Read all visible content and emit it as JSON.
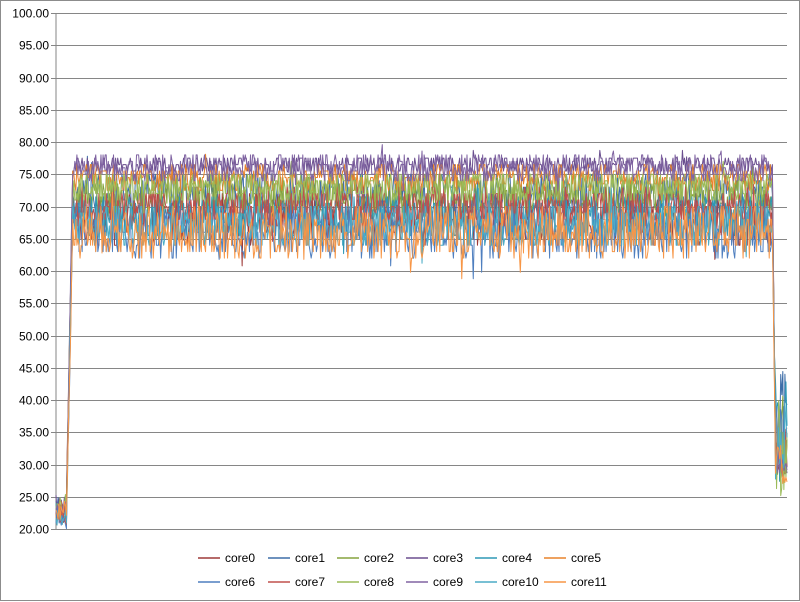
{
  "chart_data": {
    "type": "line",
    "title": "",
    "xlabel": "",
    "ylabel": "",
    "ylim": [
      20,
      100
    ],
    "y_ticks": [
      "20.00",
      "25.00",
      "30.00",
      "35.00",
      "40.00",
      "45.00",
      "50.00",
      "55.00",
      "60.00",
      "65.00",
      "70.00",
      "75.00",
      "80.00",
      "85.00",
      "90.00",
      "95.00",
      "100.00"
    ],
    "grid": true,
    "legend_position": "bottom",
    "n_points": 700,
    "series": [
      {
        "name": "core0",
        "color": "#9e3a38",
        "idle": 22.0,
        "load": 68.0,
        "amp": 4.0,
        "drop": 31.0,
        "tail_amp": 3.0
      },
      {
        "name": "core1",
        "color": "#3e6ea8",
        "idle": 23.5,
        "load": 72.0,
        "amp": 3.5,
        "drop": 35.0,
        "tail_amp": 10.0
      },
      {
        "name": "core2",
        "color": "#86a33f",
        "idle": 23.0,
        "load": 71.5,
        "amp": 3.0,
        "drop": 33.0,
        "tail_amp": 8.0
      },
      {
        "name": "core3",
        "color": "#6b4f8f",
        "idle": 24.0,
        "load": 76.5,
        "amp": 1.5,
        "drop": 30.0,
        "tail_amp": 2.0
      },
      {
        "name": "core4",
        "color": "#2f98b5",
        "idle": 22.5,
        "load": 68.5,
        "amp": 3.5,
        "drop": 36.0,
        "tail_amp": 9.0
      },
      {
        "name": "core5",
        "color": "#e8842c",
        "idle": 23.0,
        "load": 74.5,
        "amp": 2.0,
        "drop": 31.0,
        "tail_amp": 3.0
      },
      {
        "name": "core6",
        "color": "#4f7fbf",
        "idle": 22.0,
        "load": 66.0,
        "amp": 4.0,
        "drop": 34.0,
        "tail_amp": 6.0
      },
      {
        "name": "core7",
        "color": "#c0504d",
        "idle": 22.5,
        "load": 70.0,
        "amp": 3.0,
        "drop": 32.0,
        "tail_amp": 4.0
      },
      {
        "name": "core8",
        "color": "#9bbb59",
        "idle": 24.0,
        "load": 73.0,
        "amp": 2.5,
        "drop": 33.0,
        "tail_amp": 8.0
      },
      {
        "name": "core9",
        "color": "#8064a2",
        "idle": 23.0,
        "load": 76.0,
        "amp": 2.0,
        "drop": 31.0,
        "tail_amp": 3.0
      },
      {
        "name": "core10",
        "color": "#4bacc6",
        "idle": 22.0,
        "load": 67.0,
        "amp": 3.5,
        "drop": 35.0,
        "tail_amp": 8.0
      },
      {
        "name": "core11",
        "color": "#f79646",
        "idle": 23.0,
        "load": 66.0,
        "amp": 4.0,
        "drop": 30.0,
        "tail_amp": 3.0
      }
    ]
  }
}
